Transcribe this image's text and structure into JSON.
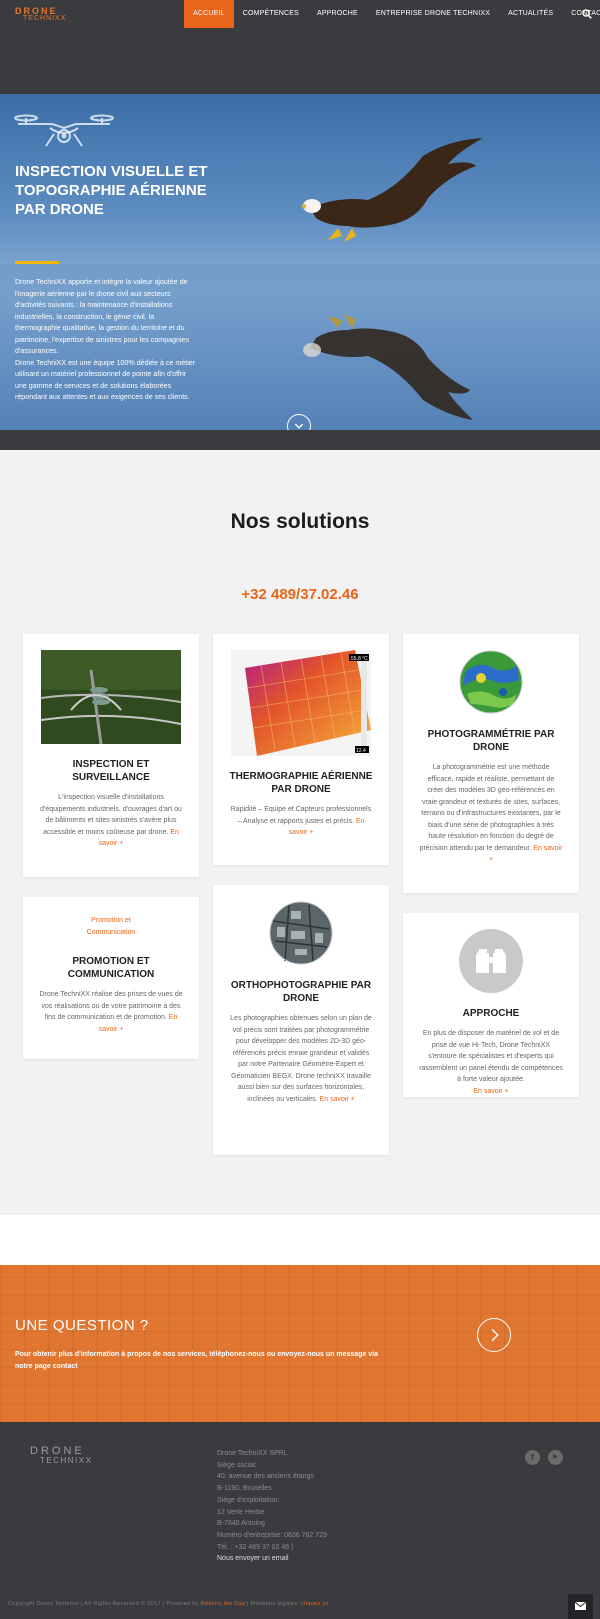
{
  "nav": {
    "logo_line1": "DRONE",
    "logo_line2": "TECHNIXX",
    "items": [
      "ACCUEIL",
      "COMPÉTENCES",
      "APPROCHE",
      "ENTREPRISE DRONE TECHNIXX",
      "ACTUALITÉS",
      "CONTACT"
    ],
    "active_index": 0,
    "search_icon": "search-icon"
  },
  "hero": {
    "title": "INSPECTION VISUELLE ET TOPOGRAPHIE AÉRIENNE PAR DRONE",
    "paragraph1": "Drone TechniXX apporte et intègre la valeur ajoutée de l'imagerie aérienne par le drone civil aux secteurs d'activités suivants : la maintenance d'installations industrielles, la construction, le génie civil, la thermographie qualitative, la gestion du territoire et du patrimoine, l'expertise de sinistres pour les compagnies d'assurances.",
    "paragraph2": "Drone TechniXX est une équipe 100% dédiée à ce métier utilisant un matériel professionnel de pointe afin d'offrir une gamme de services et de solutions élaborées répondant aux attentes et aux exigences de ses clients."
  },
  "solutions": {
    "title": "Nos solutions",
    "phone": "+32 489/37.02.46",
    "cards": [
      {
        "title": "INSPECTION ET SURVEILLANCE",
        "text": "L'inspection visuelle d'installations d'équipements industriels, d'ouvrages d'art ou de bâtiments et sites sinistrés s'avère plus accessible et moins coûteuse par drone.",
        "more": "En savoir +"
      },
      {
        "title": "THERMOGRAPHIE AÉRIENNE PAR DRONE",
        "text": "Rapidité – Equipe et Capteurs professionnels – Analyse et rapports justes et précis.",
        "more": "En savoir +",
        "thermo_max": "55.8 °C",
        "thermo_min": "12.4"
      },
      {
        "title": "PHOTOGRAMMÉTRIE PAR DRONE",
        "text": "La photogrammétrie est une méthode efficace, rapide et réaliste, permettant de créer des modèles 3D géo-référencés en vraie grandeur et texturés de sites, surfaces, terrains ou d'infrastructures existantes, par le biais d'une série de photographies à très haute résolution en fonction du degré de précision attendu par le demandeur.",
        "more": "En savoir +"
      },
      {
        "tag_line1": "Promotion et",
        "tag_line2": "Communication",
        "title": "PROMOTION ET COMMUNICATION",
        "text": "Drone TechniXX réalise des prises de vues de vos réalisations ou de votre patrimoine à des fins de communication et de promotion.",
        "more": "En savoir +"
      },
      {
        "title": "ORTHOPHOTOGRAPHIE PAR DRONE",
        "text": "Les photographies obtenues selon un plan de vol précis sont traitées par photogrammétrie pour développer des modèles 2D-3D géo-référencés précis enraie grandeur et validés par notre Partenaire Géomètre-Expert et Géomaticien BEGX. Drone techniXX travaille aussi bien sur des surfaces horizontales, inclinées ou verticales.",
        "more": "En savoir +"
      },
      {
        "title": "APPROCHE",
        "text": "En plus de disposer de matériel de vol et de prise de vue Hi-Tech, Drone TechniXX s'entoure de spécialistes et d'experts qui rassemblent un panel étendu de compétences à forte valeur ajoutée.",
        "more": "En savoir +"
      }
    ]
  },
  "question": {
    "title": "UNE QUESTION ?",
    "text": "Pour obtenir plus d'information à propos de nos services, téléphonez-nous ou envoyez-nous un message via notre page contact"
  },
  "footer": {
    "logo_line1": "DRONE",
    "logo_line2": "TECHNIXX",
    "company": "Drone TechniXX SPRL",
    "lines": [
      "Siège social:",
      "40, avenue des anciens étangs",
      "B-1190, Bruxelles",
      "Siège d'exploitation:",
      "12 Verte Herbe",
      "B-7640 Antoing",
      "Numéro d'entreprise: 0636 782 729",
      "Tél. : +32 489 37 02 46 |"
    ],
    "email_link": "Nous envoyer un email",
    "social_1": "f",
    "social_2": "▶",
    "copyright_a": "Copyright Drone Technixx | All Rights Reserved © 2017 | Powered by",
    "copyright_b": "Réécris the Day",
    "copyright_c": "| Mentions légales:",
    "copyright_d": "cliquez ici"
  }
}
